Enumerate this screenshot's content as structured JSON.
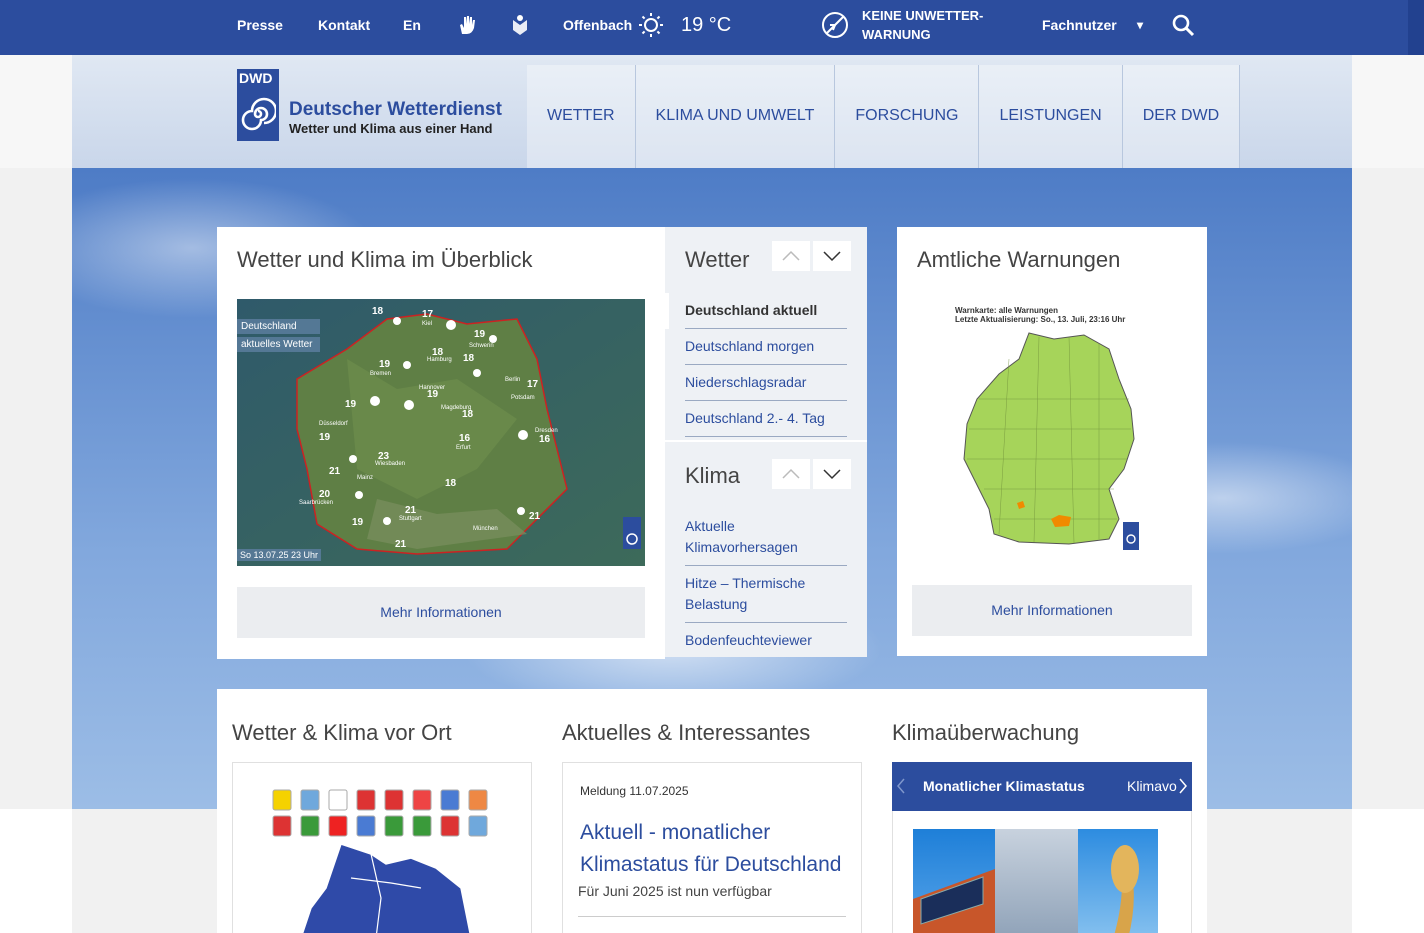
{
  "topbar": {
    "presse": "Presse",
    "kontakt": "Kontakt",
    "lang": "En",
    "location": "Offenbach",
    "temperature": "19 °C",
    "warning_line1": "KEINE UNWETTER-",
    "warning_line2": "WARNUNG",
    "user_type": "Fachnutzer",
    "dropdown_arrow": "▾"
  },
  "logo": {
    "abbr": "DWD",
    "title": "Deutscher Wetterdienst",
    "subtitle": "Wetter und Klima aus einer Hand"
  },
  "nav": [
    "WETTER",
    "KLIMA UND UMWELT",
    "FORSCHUNG",
    "LEISTUNGEN",
    "DER DWD"
  ],
  "overview": {
    "title": "Wetter und Klima im Überblick",
    "map_label_1": "Deutschland",
    "map_label_2": "aktuelles Wetter",
    "map_timestamp": "So 13.07.25 23 Uhr",
    "more": "Mehr Informationen",
    "cities": [
      "Kiel",
      "Schwerin",
      "Hamburg",
      "Bremen",
      "Berlin",
      "Potsdam",
      "Hannover",
      "Magdeburg",
      "Düsseldorf",
      "Erfurt",
      "Dresden",
      "Wiesbaden",
      "Mainz",
      "Saarbrücken",
      "Stuttgart",
      "München"
    ],
    "temps": [
      "18",
      "17",
      "19",
      "18",
      "19",
      "18",
      "17",
      "19",
      "18",
      "19",
      "16",
      "19",
      "16",
      "23",
      "21",
      "18",
      "20",
      "19",
      "21",
      "21",
      "21"
    ]
  },
  "wetter_menu": {
    "title": "Wetter",
    "links": [
      "Deutschland aktuell",
      "Deutschland morgen",
      "Niederschlagsradar",
      "Deutschland 2.- 4. Tag"
    ]
  },
  "klima_menu": {
    "title": "Klima",
    "links": [
      "Aktuelle Klimavorhersagen",
      "Hitze – Thermische Belastung",
      "Bodenfeuchteviewer"
    ]
  },
  "warnings": {
    "title": "Amtliche Warnungen",
    "map_caption_1": "Warnkarte: alle Warnungen",
    "map_caption_2": "Letzte Aktualisierung: So., 13. Juli, 23:16 Uhr",
    "more": "Mehr Informationen"
  },
  "lower": {
    "local_title": "Wetter & Klima vor Ort",
    "news_title": "Aktuelles & Interessantes",
    "news_meta": "Meldung 11.07.2025",
    "news_headline": "Aktuell - monatlicher Klimastatus für Deutschland",
    "news_teaser": "Für Juni 2025 ist nun verfügbar",
    "climate_title": "Klimaüberwachung",
    "climate_tab_active": "Monatlicher Klimastatus",
    "climate_tab_next": "Klimavorhersagen"
  },
  "colors": {
    "brand_blue": "#2c4d9e",
    "warning_green": "#a6d45a",
    "warning_orange": "#f08a00"
  }
}
